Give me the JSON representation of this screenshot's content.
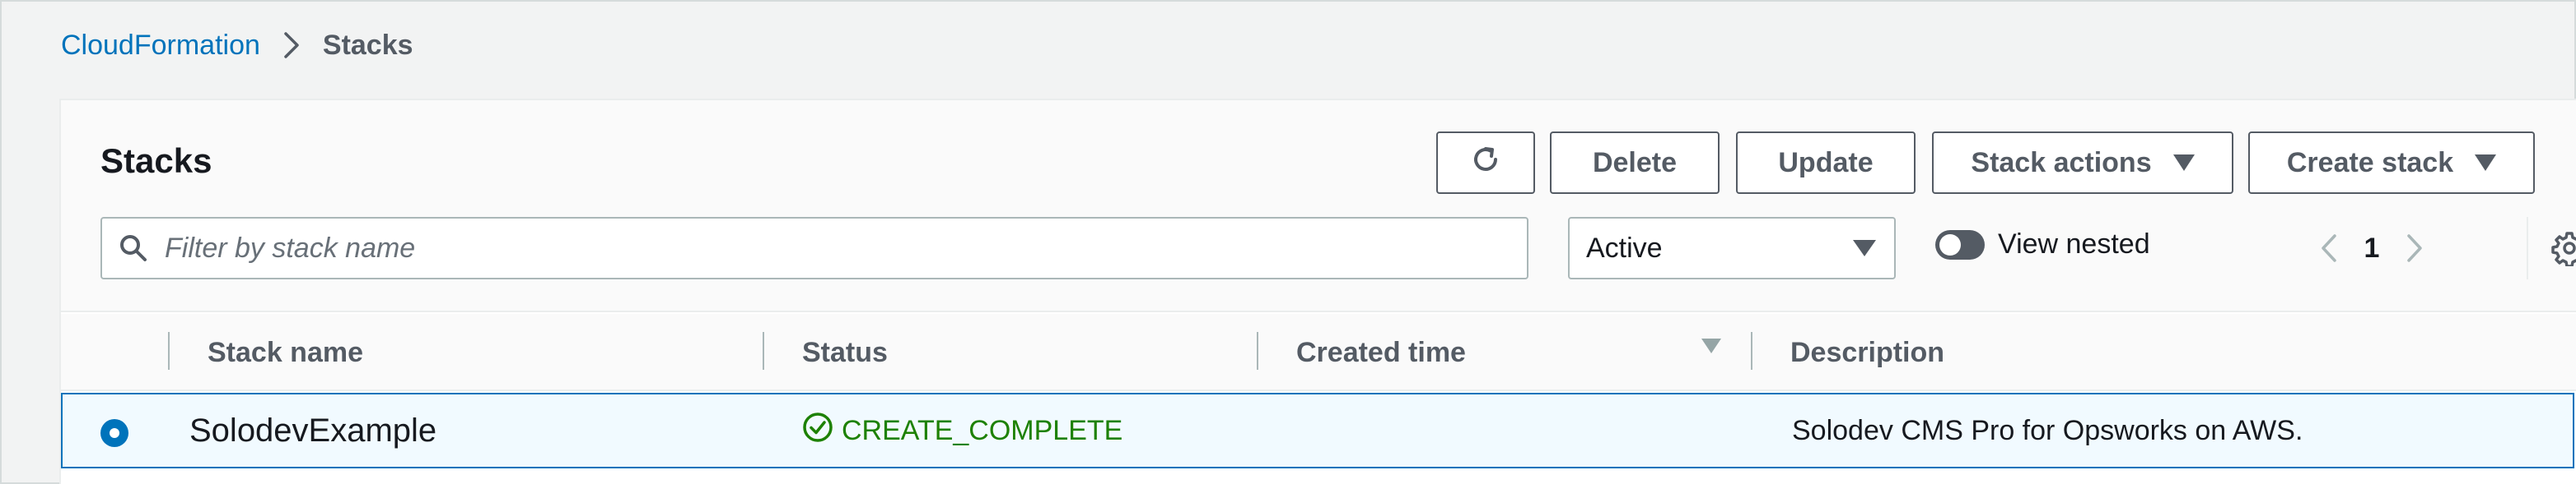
{
  "breadcrumb": {
    "parent": "CloudFormation",
    "current": "Stacks"
  },
  "panel": {
    "title": "Stacks",
    "buttons": {
      "delete": "Delete",
      "update": "Update",
      "stack_actions": "Stack actions",
      "create_stack": "Create stack"
    },
    "filter": {
      "placeholder": "Filter by stack name",
      "value": ""
    },
    "status_filter": {
      "selected": "Active"
    },
    "view_nested": {
      "label": "View nested",
      "enabled": false
    },
    "pagination": {
      "current_page": "1"
    }
  },
  "table": {
    "columns": [
      "Stack name",
      "Status",
      "Created time",
      "Description"
    ],
    "rows": [
      {
        "selected": true,
        "stack_name": "SolodevExample",
        "status": "CREATE_COMPLETE",
        "created_time": "",
        "description": "Solodev CMS Pro for Opsworks on AWS."
      }
    ]
  },
  "colors": {
    "link": "#0073bb",
    "success": "#1d8102",
    "selected_row_bg": "#f1faff",
    "selected_row_border": "#0073bb"
  },
  "icons": {
    "breadcrumb_separator": "chevron-right-icon",
    "refresh": "refresh-icon",
    "search": "search-icon",
    "dropdown": "caret-down-icon",
    "previous": "chevron-left-icon",
    "next": "chevron-right-icon",
    "settings": "gear-icon",
    "status": "check-circle-icon",
    "sort": "sort-descending-icon"
  }
}
